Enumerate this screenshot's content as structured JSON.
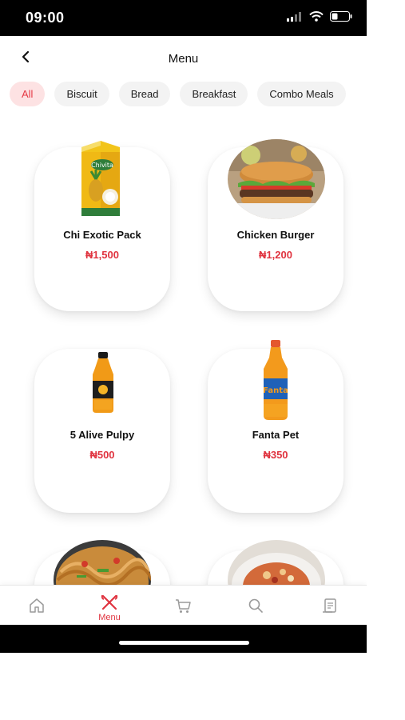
{
  "status_bar": {
    "time": "09:00"
  },
  "header": {
    "title": "Menu"
  },
  "categories": [
    {
      "label": "All",
      "active": true
    },
    {
      "label": "Biscuit",
      "active": false
    },
    {
      "label": "Bread",
      "active": false
    },
    {
      "label": "Breakfast",
      "active": false
    },
    {
      "label": "Combo Meals",
      "active": false
    }
  ],
  "products": [
    {
      "name": "Chi Exotic Pack",
      "price": "₦1,500"
    },
    {
      "name": "Chicken Burger",
      "price": "₦1,200"
    },
    {
      "name": "5 Alive Pulpy",
      "price": "₦500"
    },
    {
      "name": "Fanta Pet",
      "price": "₦350"
    }
  ],
  "bottom_nav": {
    "items": [
      {
        "icon": "home-icon",
        "label": ""
      },
      {
        "icon": "menu-icon",
        "label": "Menu",
        "active": true
      },
      {
        "icon": "cart-icon",
        "label": ""
      },
      {
        "icon": "search-icon",
        "label": ""
      },
      {
        "icon": "orders-icon",
        "label": ""
      }
    ]
  },
  "colors": {
    "accent": "#e0333f",
    "active_chip_bg": "#fde2e3"
  }
}
